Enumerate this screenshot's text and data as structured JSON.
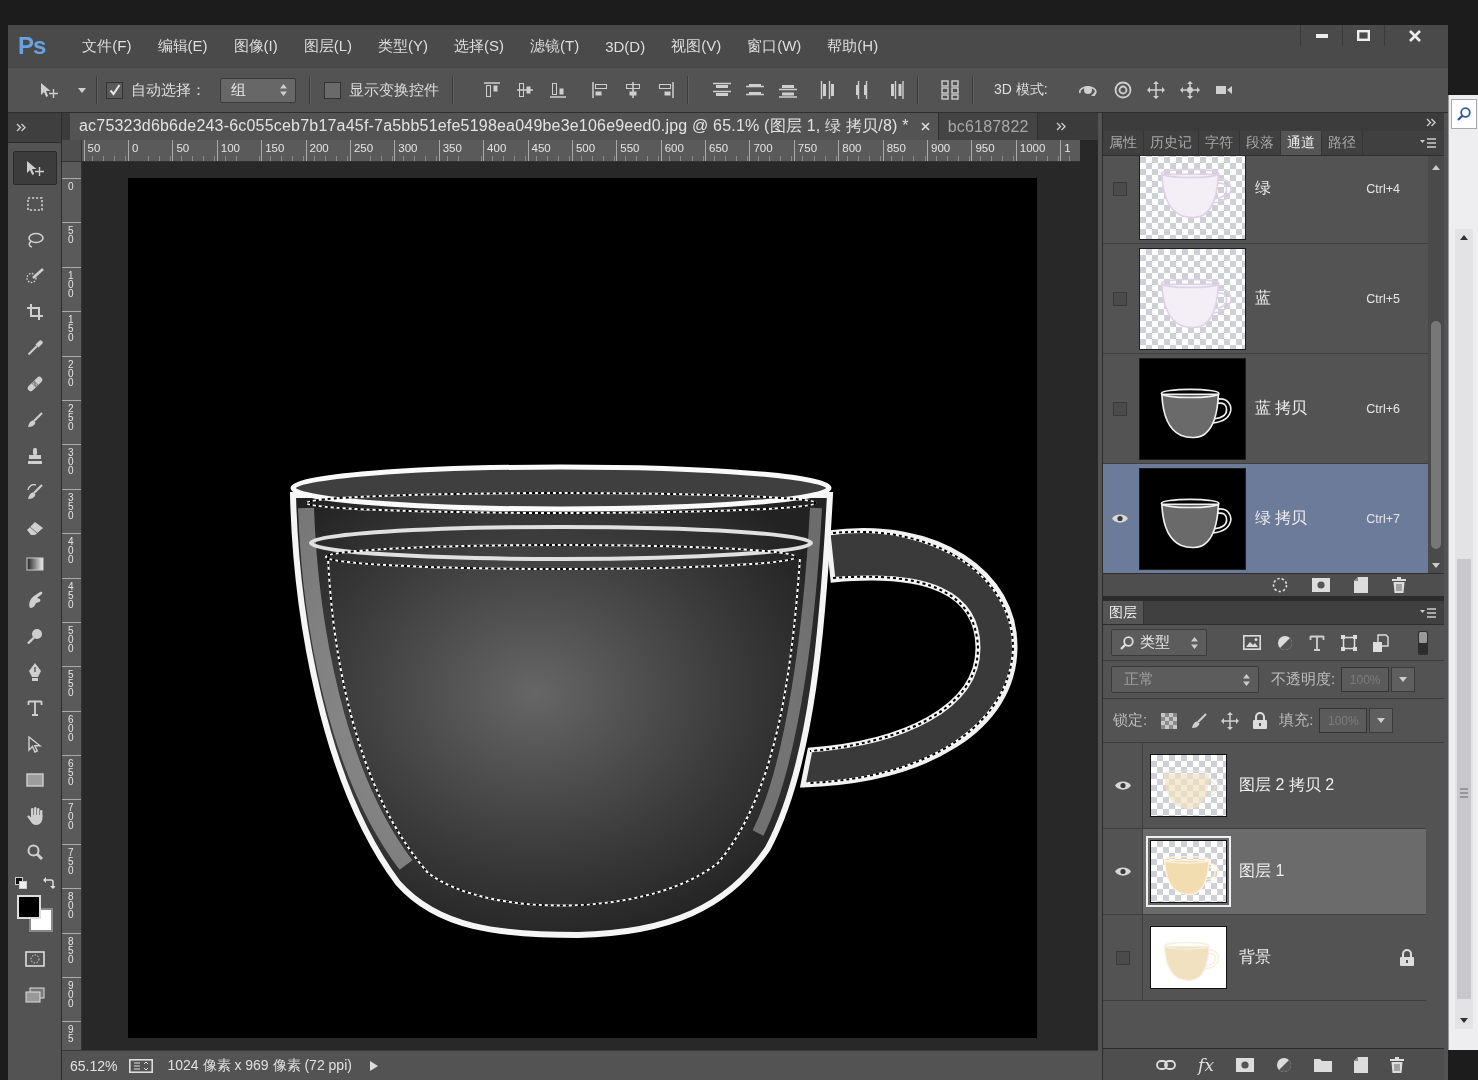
{
  "app": {
    "logo": "Ps"
  },
  "menu_bar": [
    "文件(F)",
    "编辑(E)",
    "图像(I)",
    "图层(L)",
    "类型(Y)",
    "选择(S)",
    "滤镜(T)",
    "3D(D)",
    "视图(V)",
    "窗口(W)",
    "帮助(H)"
  ],
  "options_bar": {
    "auto_select": {
      "label": "自动选择：",
      "checked": true
    },
    "auto_select_target": "组",
    "show_transform_controls": {
      "label": "显示变换控件",
      "checked": false
    },
    "mode_3d_label": "3D 模式:"
  },
  "toolbar": {
    "tools": [
      {
        "kind": "move",
        "selected": true
      },
      {
        "kind": "marquee",
        "selected": false
      },
      {
        "kind": "lasso",
        "selected": false
      },
      {
        "kind": "quick-select",
        "selected": false
      },
      {
        "kind": "crop",
        "selected": false
      },
      {
        "kind": "eyedropper",
        "selected": false
      },
      {
        "kind": "spot-heal",
        "selected": false
      },
      {
        "kind": "brush",
        "selected": false
      },
      {
        "kind": "stamp",
        "selected": false
      },
      {
        "kind": "history-brush",
        "selected": false
      },
      {
        "kind": "eraser",
        "selected": false
      },
      {
        "kind": "gradient",
        "selected": false
      },
      {
        "kind": "smudge",
        "selected": false
      },
      {
        "kind": "dodge",
        "selected": false
      },
      {
        "kind": "pen",
        "selected": false
      },
      {
        "kind": "type",
        "selected": false
      },
      {
        "kind": "path-select",
        "selected": false
      },
      {
        "kind": "shape",
        "selected": false
      },
      {
        "kind": "hand",
        "selected": false
      },
      {
        "kind": "zoom",
        "selected": false
      }
    ]
  },
  "document_tabs": [
    {
      "label": "ac75323d6b6de243-6c055ceb7b17a45f-7a5bb51efe5198ea049be3e106e9eed0.jpg @ 65.1% (图层 1, 绿 拷贝/8) *",
      "selected": true
    },
    {
      "label": "bc6187822",
      "selected": false
    }
  ],
  "rulers": {
    "horizontal": [
      "50",
      "0",
      "50",
      "100",
      "150",
      "200",
      "250",
      "300",
      "350",
      "400",
      "450",
      "500",
      "550",
      "600",
      "650",
      "700",
      "750",
      "800",
      "850",
      "900",
      "950",
      "1000",
      "1"
    ],
    "vertical": [
      "0",
      "50",
      "100",
      "150",
      "200",
      "250",
      "300",
      "350",
      "400",
      "450",
      "500",
      "550",
      "600",
      "650",
      "700",
      "750",
      "800",
      "850",
      "900",
      "95"
    ]
  },
  "status_bar": {
    "zoom": "65.12%",
    "document_info": "1024 像素 x 969 像素 (72 ppi)"
  },
  "channels_panel": {
    "tabs": [
      {
        "label": "属性",
        "selected": false
      },
      {
        "label": "历史记",
        "selected": false
      },
      {
        "label": "字符",
        "selected": false
      },
      {
        "label": "段落",
        "selected": false
      },
      {
        "label": "通道",
        "selected": true
      },
      {
        "label": "路径",
        "selected": false
      }
    ],
    "channels": [
      {
        "name": "绿",
        "shortcut": "Ctrl+4",
        "kind": "transparent",
        "visible": false,
        "selected": false
      },
      {
        "name": "蓝",
        "shortcut": "Ctrl+5",
        "kind": "transparent",
        "visible": false,
        "selected": false
      },
      {
        "name": "蓝 拷贝",
        "shortcut": "Ctrl+6",
        "kind": "dark",
        "visible": false,
        "selected": false
      },
      {
        "name": "绿 拷贝",
        "shortcut": "Ctrl+7",
        "kind": "dark",
        "visible": true,
        "selected": true
      }
    ]
  },
  "layers_panel": {
    "tabs": [
      {
        "label": "图层",
        "selected": true
      }
    ],
    "filter": "类型",
    "blend_mode": {
      "value": "正常",
      "disabled": true
    },
    "opacity": {
      "label": "不透明度:",
      "value": "100%",
      "disabled": true
    },
    "lock_label": "锁定:",
    "fill": {
      "label": "填充:",
      "value": "100%",
      "disabled": true
    },
    "layers": [
      {
        "name": "图层 2 拷贝 2",
        "kind": "faded",
        "visible": true,
        "selected": false,
        "locked": false
      },
      {
        "name": "图层 1",
        "kind": "solid",
        "visible": true,
        "selected": true,
        "locked": false
      },
      {
        "name": "背景",
        "kind": "background",
        "visible": false,
        "selected": false,
        "locked": true
      }
    ],
    "effects_button": "fx"
  }
}
